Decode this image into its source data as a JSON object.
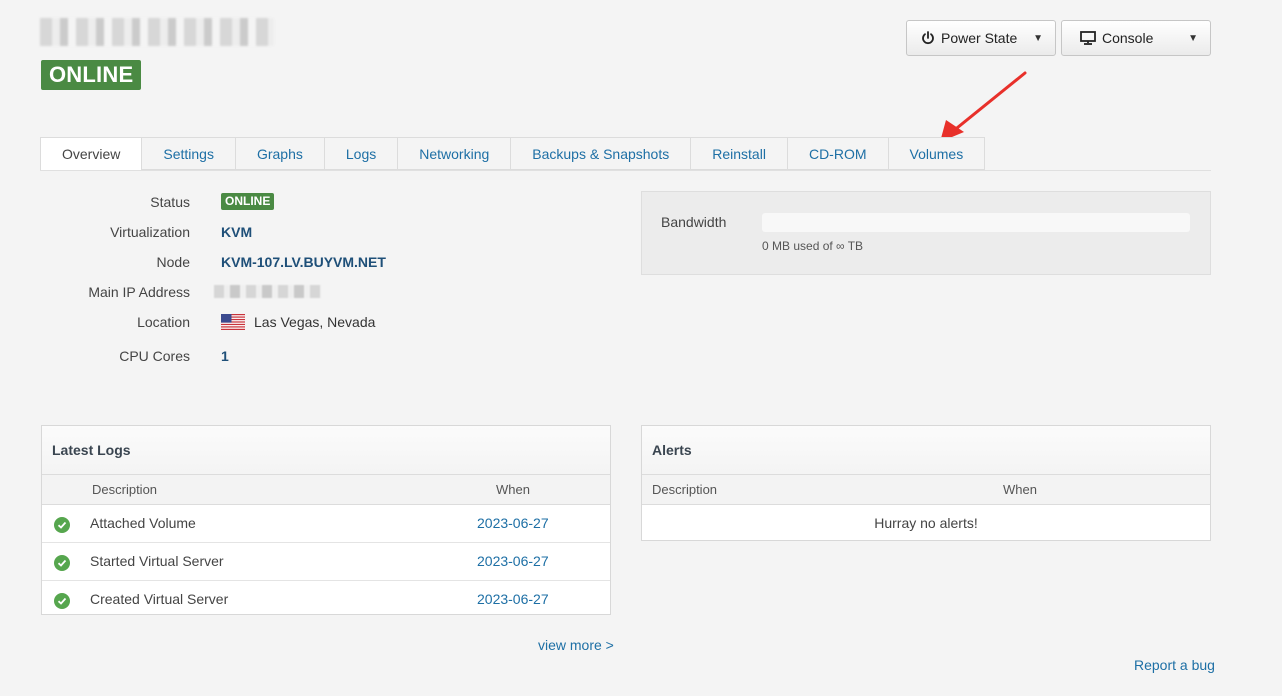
{
  "header": {
    "status_badge": "ONLINE",
    "power_state_label": "Power State",
    "console_label": "Console"
  },
  "tabs": [
    {
      "label": "Overview"
    },
    {
      "label": "Settings"
    },
    {
      "label": "Graphs"
    },
    {
      "label": "Logs"
    },
    {
      "label": "Networking"
    },
    {
      "label": "Backups & Snapshots"
    },
    {
      "label": "Reinstall"
    },
    {
      "label": "CD-ROM"
    },
    {
      "label": "Volumes"
    }
  ],
  "info": {
    "status_label": "Status",
    "status_value": "ONLINE",
    "virtualization_label": "Virtualization",
    "virtualization_value": "KVM",
    "node_label": "Node",
    "node_value": "KVM-107.LV.BUYVM.NET",
    "ip_label": "Main IP Address",
    "location_label": "Location",
    "location_value": "Las Vegas, Nevada",
    "cpu_label": "CPU Cores",
    "cpu_value": "1"
  },
  "bandwidth": {
    "label": "Bandwidth",
    "usage_text": "0 MB used of ∞ TB",
    "used_fraction": 0
  },
  "latest_logs": {
    "title": "Latest Logs",
    "col_description": "Description",
    "col_when": "When",
    "rows": [
      {
        "description": "Attached Volume",
        "when": "2023-06-27"
      },
      {
        "description": "Started Virtual Server",
        "when": "2023-06-27"
      },
      {
        "description": "Created Virtual Server",
        "when": "2023-06-27"
      }
    ],
    "view_more": "view more >"
  },
  "alerts": {
    "title": "Alerts",
    "col_description": "Description",
    "col_when": "When",
    "empty_text": "Hurray no alerts!"
  },
  "footer": {
    "report_bug": "Report a bug"
  },
  "colors": {
    "online_green": "#4a8a43",
    "link_blue": "#1d6fa5",
    "annotation_red": "#e8302a"
  }
}
